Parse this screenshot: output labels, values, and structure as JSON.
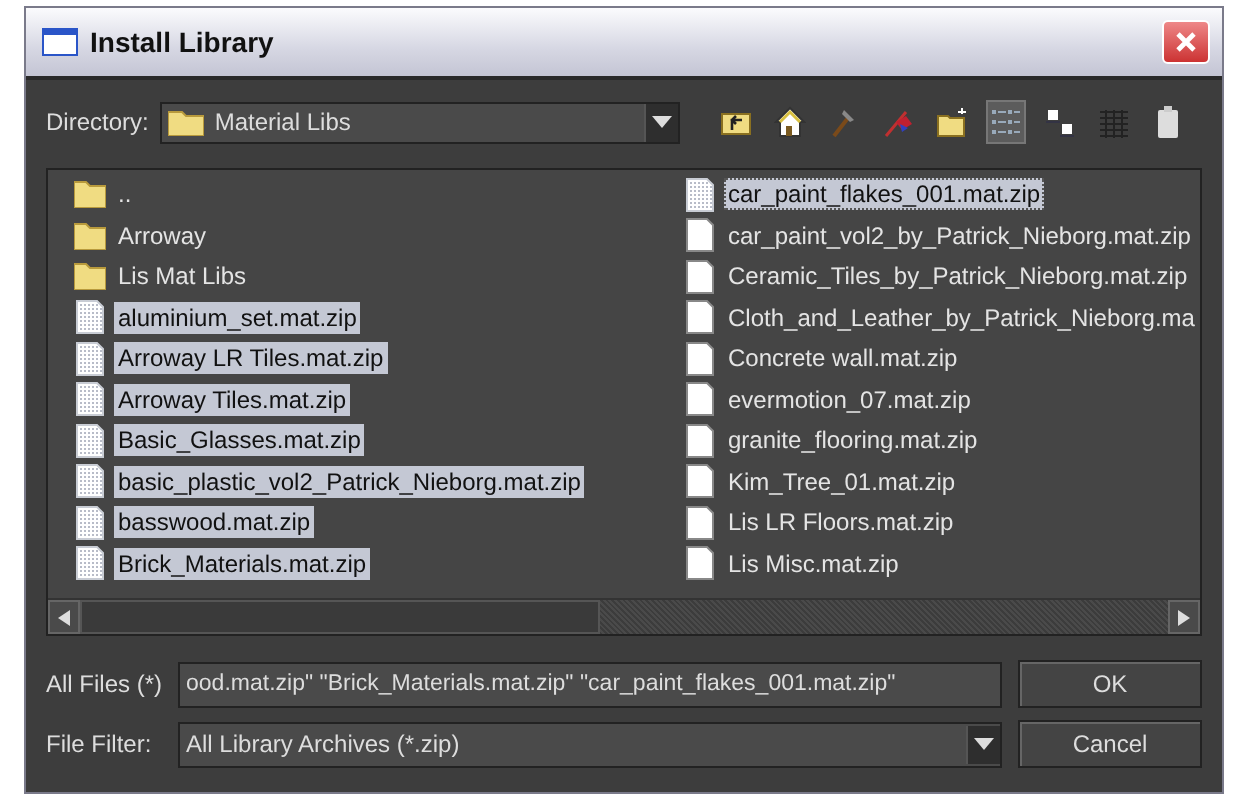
{
  "window": {
    "title": "Install Library"
  },
  "directory": {
    "label": "Directory:",
    "value": "Material Libs"
  },
  "toolbar": [
    {
      "kind": "up",
      "selected": false
    },
    {
      "kind": "home",
      "selected": false
    },
    {
      "kind": "hammer",
      "selected": false
    },
    {
      "kind": "flag",
      "selected": false
    },
    {
      "kind": "newfolder",
      "selected": false
    },
    {
      "kind": "list",
      "selected": true
    },
    {
      "kind": "details",
      "selected": false
    },
    {
      "kind": "grid",
      "selected": false
    },
    {
      "kind": "clipboard",
      "selected": false
    }
  ],
  "files": [
    {
      "kind": "folder",
      "name": "..",
      "selected": false,
      "focused": false
    },
    {
      "kind": "folder",
      "name": "Arroway",
      "selected": false,
      "focused": false
    },
    {
      "kind": "folder",
      "name": "Lis Mat Libs",
      "selected": false,
      "focused": false
    },
    {
      "kind": "file",
      "name": "aluminium_set.mat.zip",
      "selected": true,
      "focused": false
    },
    {
      "kind": "file",
      "name": "Arroway LR Tiles.mat.zip",
      "selected": true,
      "focused": false
    },
    {
      "kind": "file",
      "name": "Arroway Tiles.mat.zip",
      "selected": true,
      "focused": false
    },
    {
      "kind": "file",
      "name": "Basic_Glasses.mat.zip",
      "selected": true,
      "focused": false
    },
    {
      "kind": "file",
      "name": "basic_plastic_vol2_Patrick_Nieborg.mat.zip",
      "selected": true,
      "focused": false
    },
    {
      "kind": "file",
      "name": "basswood.mat.zip",
      "selected": true,
      "focused": false
    },
    {
      "kind": "file",
      "name": "Brick_Materials.mat.zip",
      "selected": true,
      "focused": false
    },
    {
      "kind": "file",
      "name": "car_paint_flakes_001.mat.zip",
      "selected": true,
      "focused": true
    },
    {
      "kind": "file",
      "name": "car_paint_vol2_by_Patrick_Nieborg.mat.zip",
      "selected": false,
      "focused": false
    },
    {
      "kind": "file",
      "name": "Ceramic_Tiles_by_Patrick_Nieborg.mat.zip",
      "selected": false,
      "focused": false
    },
    {
      "kind": "file",
      "name": "Cloth_and_Leather_by_Patrick_Nieborg.ma",
      "selected": false,
      "focused": false
    },
    {
      "kind": "file",
      "name": "Concrete wall.mat.zip",
      "selected": false,
      "focused": false
    },
    {
      "kind": "file",
      "name": "evermotion_07.mat.zip",
      "selected": false,
      "focused": false
    },
    {
      "kind": "file",
      "name": "granite_flooring.mat.zip",
      "selected": false,
      "focused": false
    },
    {
      "kind": "file",
      "name": "Kim_Tree_01.mat.zip",
      "selected": false,
      "focused": false
    },
    {
      "kind": "file",
      "name": "Lis LR Floors.mat.zip",
      "selected": false,
      "focused": false
    },
    {
      "kind": "file",
      "name": "Lis Misc.mat.zip",
      "selected": false,
      "focused": false
    }
  ],
  "file_name": {
    "label": "All Files (*)",
    "value": "ood.mat.zip\" \"Brick_Materials.mat.zip\" \"car_paint_flakes_001.mat.zip\""
  },
  "file_filter": {
    "label": "File Filter:",
    "value": "All Library Archives (*.zip)"
  },
  "buttons": [
    "OK",
    "Cancel"
  ]
}
